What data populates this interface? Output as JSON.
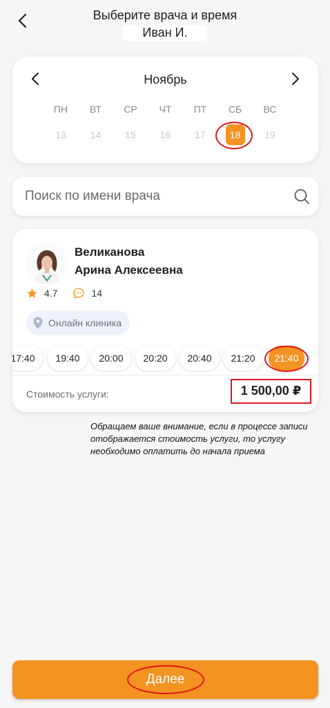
{
  "header": {
    "title": "Выберите врача и время",
    "patient_name": "Иван И."
  },
  "calendar": {
    "month": "Ноябрь",
    "weekdays": [
      "ПН",
      "ВТ",
      "СР",
      "ЧТ",
      "ПТ",
      "СБ",
      "ВС"
    ],
    "dates": [
      "13",
      "14",
      "15",
      "16",
      "17",
      "18",
      "19"
    ],
    "selected_date": "18"
  },
  "search": {
    "placeholder": "Поиск по имени врача"
  },
  "doctor": {
    "last_name": "Великанова",
    "first_names": "Арина Алексеевна",
    "rating": "4.7",
    "reviews": "14",
    "clinic": "Онлайн клиника",
    "slots": [
      "17:40",
      "19:40",
      "20:00",
      "20:20",
      "20:40",
      "21:20",
      "21:40"
    ],
    "selected_slot": "21:40",
    "cost_label": "Стоимость услуги:",
    "price": "1 500,00 ₽"
  },
  "note": "Обращаем ваше внимание, если в процессе записи отображается стоимость услуги, то услугу необходимо оплатить до начала приема",
  "actions": {
    "next_label": "Далее"
  },
  "colors": {
    "accent": "#f39322",
    "annotation": "#e0141e",
    "background": "#f6f6f8"
  }
}
